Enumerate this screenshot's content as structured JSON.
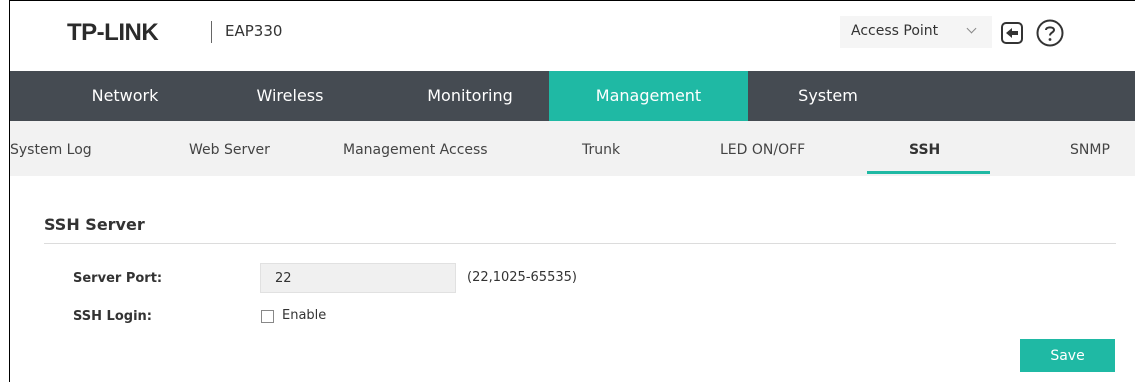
{
  "header": {
    "logo": "TP-LINK",
    "model": "EAP330",
    "mode_select": {
      "value": "Access Point"
    },
    "icons": [
      "logout-icon",
      "help-icon"
    ]
  },
  "main_nav": {
    "items": [
      {
        "label": "Network"
      },
      {
        "label": "Wireless"
      },
      {
        "label": "Monitoring"
      },
      {
        "label": "Management",
        "active": true
      },
      {
        "label": "System"
      }
    ]
  },
  "sub_nav": {
    "items": [
      {
        "label": "System Log"
      },
      {
        "label": "Web Server"
      },
      {
        "label": "Management Access"
      },
      {
        "label": "Trunk"
      },
      {
        "label": "LED ON/OFF"
      },
      {
        "label": "SSH",
        "active": true
      },
      {
        "label": "SNMP"
      }
    ]
  },
  "ssh_server": {
    "title": "SSH Server",
    "server_port": {
      "label": "Server Port:",
      "value": "22",
      "hint": "(22,1025-65535)"
    },
    "ssh_login": {
      "label": "SSH Login:",
      "option_label": "Enable",
      "checked": false
    },
    "save_label": "Save"
  },
  "colors": {
    "accent": "#1fb9a4",
    "nav_background": "#454b52",
    "subnav_background": "#f2f2f2"
  }
}
